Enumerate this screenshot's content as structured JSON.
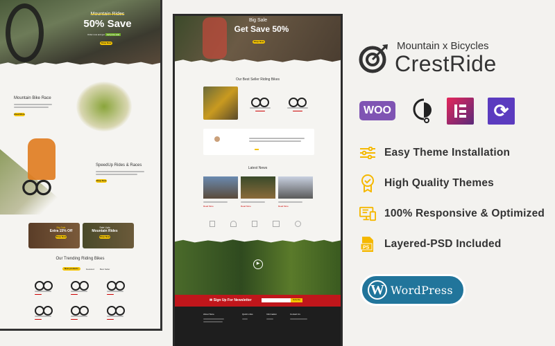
{
  "brand": {
    "tagline": "Mountain x Bicycles",
    "name": "CrestRide"
  },
  "plugins": [
    {
      "name": "woocommerce-icon",
      "label": "WOO"
    },
    {
      "name": "quickchat-icon"
    },
    {
      "name": "elementor-icon"
    },
    {
      "name": "updraft-icon"
    }
  ],
  "features": [
    {
      "icon": "sliders-icon",
      "label": "Easy Theme Installation"
    },
    {
      "icon": "award-badge-icon",
      "label": "High Quality Themes"
    },
    {
      "icon": "responsive-devices-icon",
      "label": "100% Responsive & Optimized"
    },
    {
      "icon": "psd-file-icon",
      "label": "Layered-PSD Included"
    }
  ],
  "wordpress": {
    "label": "WordPress"
  },
  "colors": {
    "accent": "#f5b800",
    "newsletter": "#c0161b",
    "footer": "#1e1e1e",
    "wordpress": "#21759b"
  },
  "left_preview": {
    "hero": {
      "strike": "Mountain Rides",
      "headline": "50% Save",
      "sub": "Order now and get",
      "sale": "half price sale",
      "button": "Shop Now"
    },
    "section1": {
      "title": "Mountain Bike Race",
      "button": "Read More"
    },
    "section2": {
      "title": "SpeedUp Rides & Races",
      "button": "Shop Now"
    },
    "banners": [
      {
        "small": "Big Sale",
        "big": "Extra 15% Off",
        "button": "Shop Now"
      },
      {
        "small": "Sale Upto",
        "big": "Mountain Rides",
        "button": "Shop Now"
      }
    ],
    "trending": {
      "title": "Our Trending Riding Bikes",
      "tabs": [
        "New products",
        "Featured",
        "Best Seller"
      ]
    }
  },
  "center_preview": {
    "hero": {
      "small": "Big Sale",
      "headline": "Get Save 50%",
      "button": "Shop Now"
    },
    "best": {
      "title": "Our Best Seller Riding Bikes"
    },
    "news": {
      "title": "Latest News",
      "read_more": "Read More"
    },
    "newsletter": {
      "label": "Sign Up For Newsletter",
      "button": "Subscribe"
    },
    "footer": {
      "cols": [
        "About Store",
        "Quick Links",
        "Information",
        "Contact Us"
      ]
    }
  }
}
